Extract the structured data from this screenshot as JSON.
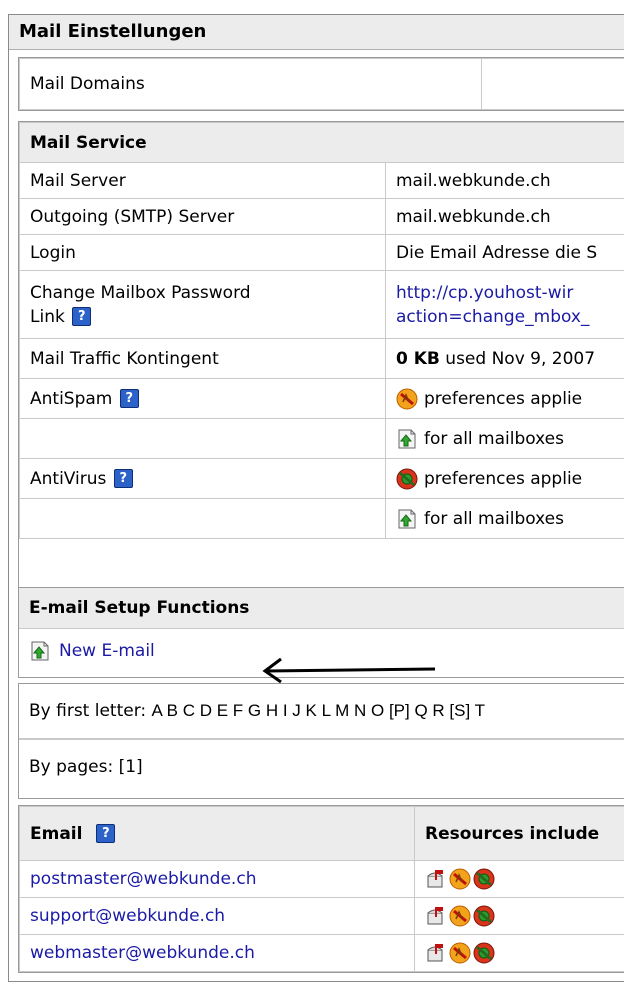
{
  "panel": {
    "title": "Mail Einstellungen"
  },
  "mail_domains": {
    "label": "Mail Domains"
  },
  "mail_service": {
    "header": "Mail Service",
    "rows": [
      {
        "label": "Mail Server",
        "value": "mail.webkunde.ch"
      },
      {
        "label": "Outgoing (SMTP) Server",
        "value": "mail.webkunde.ch"
      },
      {
        "label": "Login",
        "value": "Die Email Adresse die S"
      },
      {
        "label_line1": "Change Mailbox Password",
        "label_line2": "Link",
        "value_line1": "http://cp.youhost-wir",
        "value_line2": "action=change_mbox_"
      },
      {
        "label": "Mail Traffic Kontingent",
        "value_bold": "0 KB",
        "value_rest": " used Nov 9, 2007"
      },
      {
        "label": "AntiSpam",
        "value": "preferences applie"
      },
      {
        "label": "",
        "value": "for all mailboxes"
      },
      {
        "label": "AntiVirus",
        "value": "preferences applie"
      },
      {
        "label": "",
        "value": "for all mailboxes"
      }
    ]
  },
  "setup": {
    "header": "E-mail Setup Functions",
    "new_email": "New E-mail"
  },
  "filters": {
    "by_letter_label": "By first letter:",
    "letters": "A B C D E F G H I J K L M N O [P] Q R [S] T",
    "by_pages_label": "By pages:",
    "pages": "[1]"
  },
  "email_table": {
    "col_email": "Email",
    "col_resources": "Resources include",
    "rows": [
      {
        "email": "postmaster@webkunde.ch"
      },
      {
        "email": "support@webkunde.ch"
      },
      {
        "email": "webmaster@webkunde.ch"
      }
    ]
  },
  "colors": {
    "link": "#1a1aa6",
    "header_bg": "#ececec",
    "help_bg": "#2d63c8"
  }
}
